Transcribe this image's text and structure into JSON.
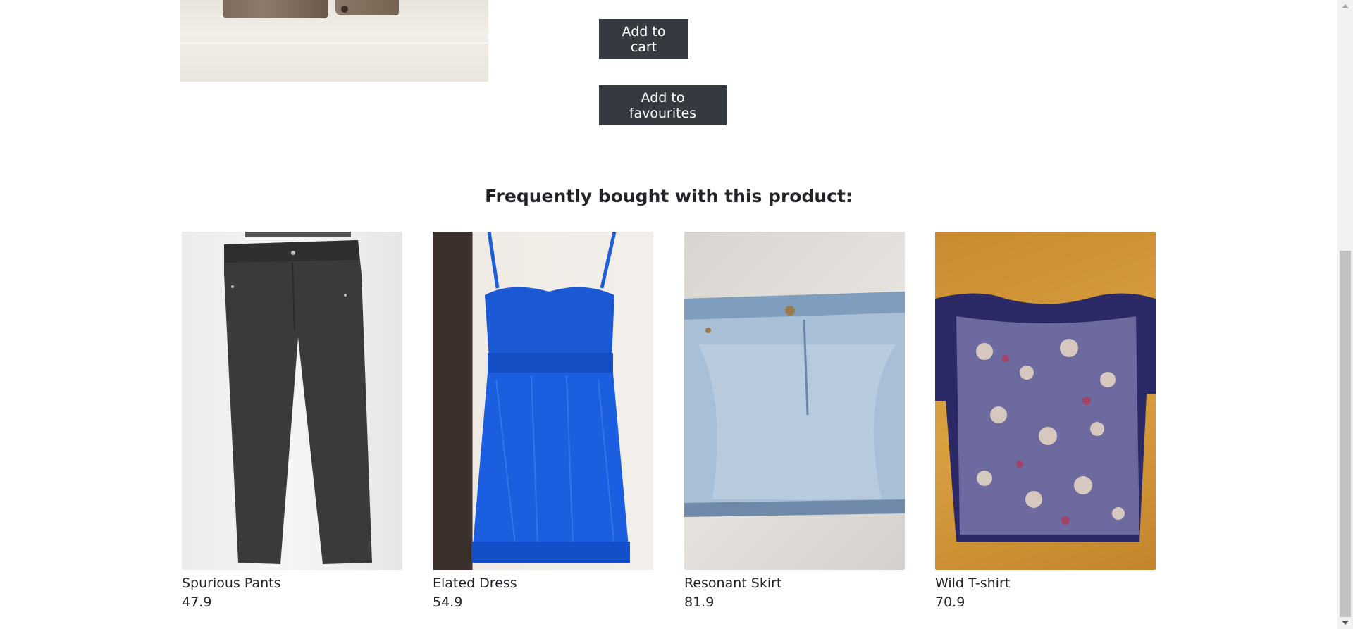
{
  "actions": {
    "add_to_cart": "Add to cart",
    "add_to_favourites": "Add to favourites"
  },
  "related": {
    "heading": "Frequently bought with this product:",
    "products": [
      {
        "name": "Spurious Pants",
        "price": "47.9"
      },
      {
        "name": "Elated Dress",
        "price": "54.9"
      },
      {
        "name": "Resonant Skirt",
        "price": "81.9"
      },
      {
        "name": "Wild T-shirt",
        "price": "70.9"
      }
    ]
  },
  "colors": {
    "button_bg": "#343a40",
    "button_text": "#ffffff",
    "text": "#212529"
  }
}
